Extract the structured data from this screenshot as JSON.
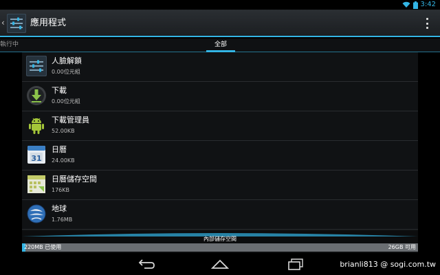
{
  "status_bar": {
    "time": "3:42",
    "icons": [
      "wifi-icon",
      "battery-icon"
    ]
  },
  "action_bar": {
    "title": "應用程式",
    "icon": "settings-sliders-icon",
    "overflow_icon": "overflow-menu-icon"
  },
  "tabs": {
    "running": "執行中",
    "all": "全部"
  },
  "apps": [
    {
      "name": "人臉解鎖",
      "size": "0.00位元組",
      "icon": "settings-sliders-icon"
    },
    {
      "name": "下載",
      "size": "0.00位元組",
      "icon": "download-icon"
    },
    {
      "name": "下載管理員",
      "size": "52.00KB",
      "icon": "android-robot-icon"
    },
    {
      "name": "日曆",
      "size": "24.00KB",
      "icon": "calendar-icon"
    },
    {
      "name": "日曆儲存空間",
      "size": "176KB",
      "icon": "calendar-storage-icon"
    },
    {
      "name": "地球",
      "size": "1.76MB",
      "icon": "globe-icon"
    }
  ],
  "storage": {
    "title": "內部儲存空間",
    "used": "220MB 已使用",
    "free": "26GB 可用",
    "used_fraction": 0.008
  },
  "nav_bar": {
    "back_icon": "back-icon",
    "home_icon": "home-icon",
    "recents_icon": "recent-apps-icon"
  },
  "watermark": "brianli813  @ sogi.com.tw",
  "colors": {
    "accent": "#33b5e5",
    "background": "#101214"
  }
}
